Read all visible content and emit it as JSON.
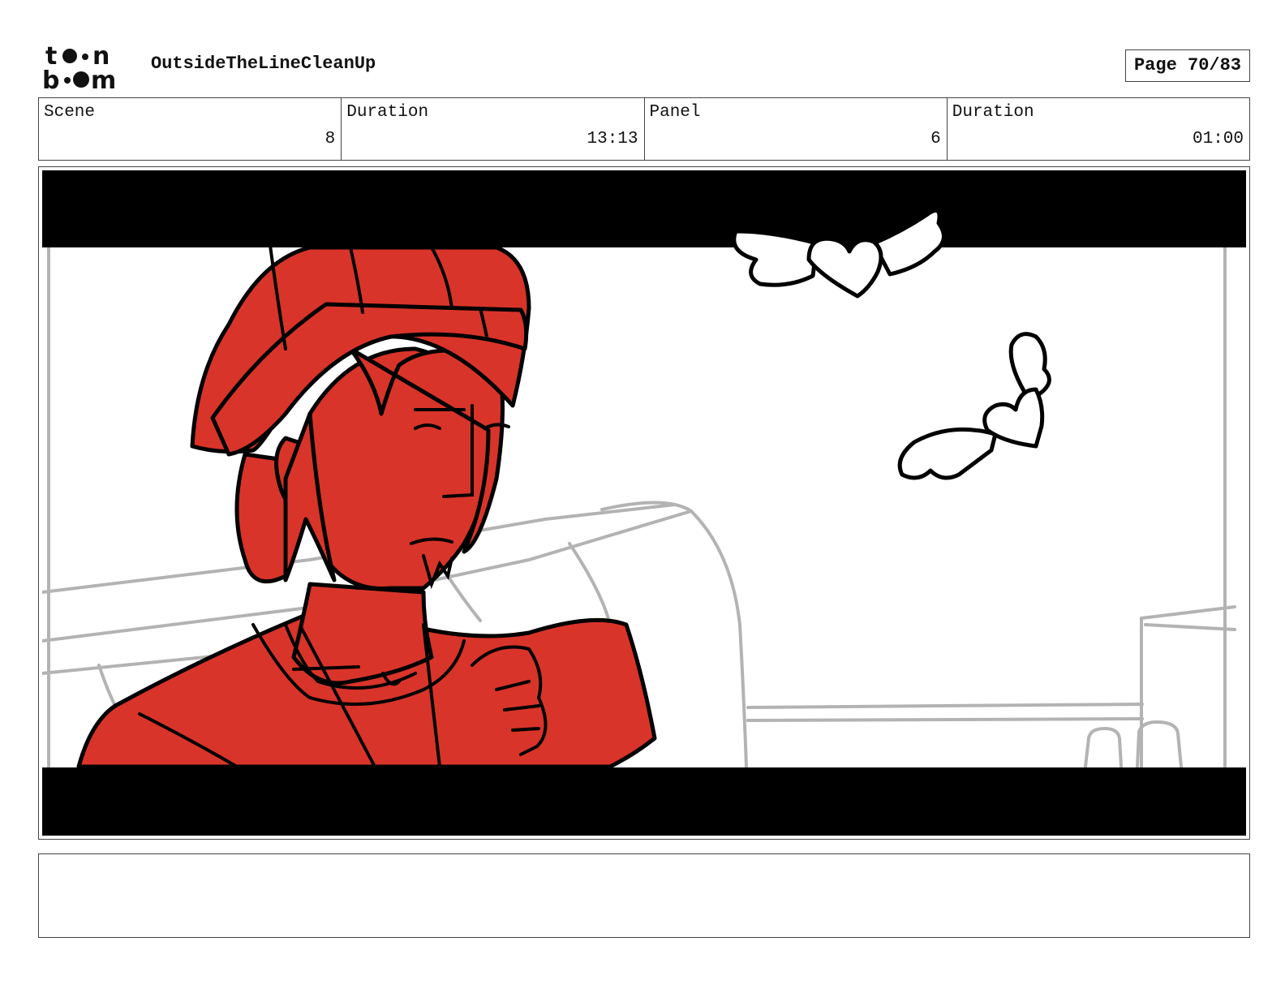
{
  "header": {
    "logo_text_top": "toon",
    "logo_text_bottom": "boom",
    "project_title": "OutsideTheLineCleanUp",
    "page_label": "Page 70/83"
  },
  "info": {
    "scene_label": "Scene",
    "scene_value": "8",
    "scene_duration_label": "Duration",
    "scene_duration_value": "13:13",
    "panel_label": "Panel",
    "panel_value": "6",
    "panel_duration_label": "Duration",
    "panel_duration_value": "01:00"
  },
  "panel": {
    "subject": "red-character-with-beanie",
    "character_color": "#d93429",
    "sketch_color": "#b3b3b3",
    "letterbox_color": "#000000"
  },
  "notes": {
    "text": ""
  }
}
